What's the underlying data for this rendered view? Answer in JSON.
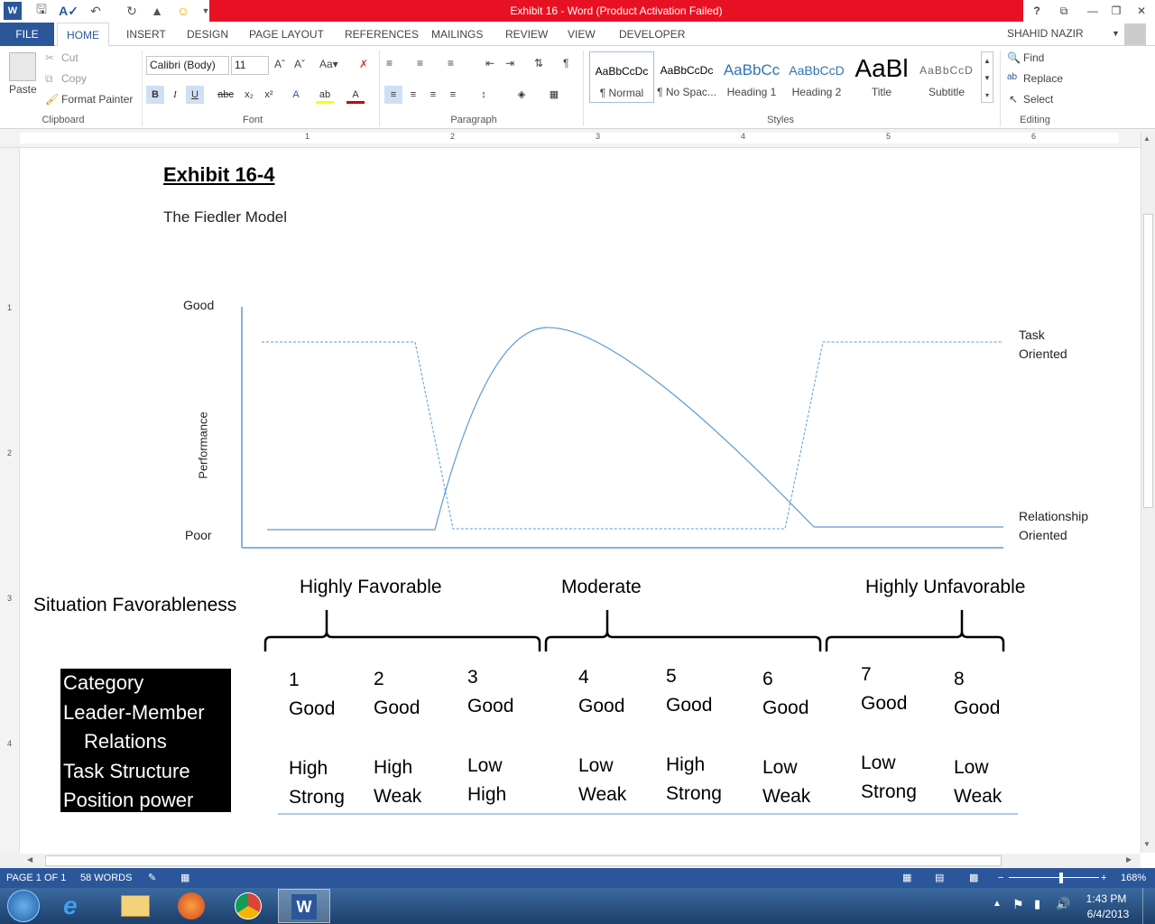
{
  "window": {
    "title": "Exhibit 16 -  Word (Product Activation Failed)",
    "help_label": "?"
  },
  "tabs": [
    "FILE",
    "HOME",
    "INSERT",
    "DESIGN",
    "PAGE LAYOUT",
    "REFERENCES",
    "MAILINGS",
    "REVIEW",
    "VIEW",
    "DEVELOPER"
  ],
  "user": "SHAHID NAZIR",
  "clipboard": {
    "paste": "Paste",
    "cut": "Cut",
    "copy": "Copy",
    "format_painter": "Format Painter",
    "label": "Clipboard"
  },
  "font": {
    "name": "Calibri (Body)",
    "size": "11",
    "label": "Font"
  },
  "paragraph": {
    "label": "Paragraph"
  },
  "styles": {
    "label": "Styles",
    "items": [
      {
        "preview": "AaBbCcDc",
        "name": "¶ Normal"
      },
      {
        "preview": "AaBbCcDc",
        "name": "¶ No Spac..."
      },
      {
        "preview": "AaBbCc",
        "name": "Heading 1"
      },
      {
        "preview": "AaBbCcD",
        "name": "Heading 2"
      },
      {
        "preview": "AaBl",
        "name": "Title"
      },
      {
        "preview": "AaBbCcD",
        "name": "Subtitle"
      }
    ]
  },
  "editing": {
    "find": "Find",
    "replace": "Replace",
    "select": "Select",
    "label": "Editing"
  },
  "ruler_numbers": [
    "1",
    "2",
    "3",
    "4",
    "5",
    "6"
  ],
  "vruler_numbers": [
    "1",
    "2",
    "3",
    "4"
  ],
  "doc": {
    "heading": "Exhibit 16-4",
    "subtitle": "The Fiedler Model",
    "y_good": "Good",
    "y_poor": "Poor",
    "y_axis": "Performance",
    "task_label_1": "Task",
    "task_label_2": "Oriented",
    "rel_label_1": "Relationship",
    "rel_label_2": "Oriented",
    "situation": "Situation Favorableness",
    "fav_high": "Highly Favorable",
    "fav_mod": "Moderate",
    "fav_unfav": "Highly Unfavorable",
    "category_lines": [
      "Category",
      "Leader-Member",
      "Relations",
      "Task Structure",
      "Position power"
    ],
    "columns": [
      {
        "num": "1",
        "lmr": "Good",
        "ts": "High",
        "pp": "Strong"
      },
      {
        "num": "2",
        "lmr": "Good",
        "ts": "High",
        "pp": "Weak"
      },
      {
        "num": "3",
        "lmr": "Good",
        "ts": "Low",
        "pp": "High"
      },
      {
        "num": "4",
        "lmr": "Good",
        "ts": "Low",
        "pp": "Weak"
      },
      {
        "num": "5",
        "lmr": "Good",
        "ts": "High",
        "pp": "Strong"
      },
      {
        "num": "6",
        "lmr": "Good",
        "ts": "Low",
        "pp": "Weak"
      },
      {
        "num": "7",
        "lmr": "Good",
        "ts": "Low",
        "pp": "Strong"
      },
      {
        "num": "8",
        "lmr": "Good",
        "ts": "Low",
        "pp": "Weak"
      }
    ]
  },
  "chart_data": {
    "type": "line",
    "ylabel": "Performance",
    "x": [
      1,
      2,
      3,
      4,
      5,
      6,
      7,
      8
    ],
    "series": [
      {
        "name": "Task Oriented",
        "style": "dashed",
        "values": [
          "high",
          "high",
          "low",
          "low",
          "low",
          "low",
          "high",
          "high"
        ]
      },
      {
        "name": "Relationship Oriented",
        "style": "solid",
        "values": [
          "low",
          "low",
          "peak",
          "high",
          "medium",
          "low",
          "low",
          "low"
        ]
      }
    ]
  },
  "status": {
    "page": "PAGE 1 OF 1",
    "words": "58 WORDS",
    "zoom": "168%"
  },
  "clock": {
    "time": "1:43 PM",
    "date": "6/4/2013"
  },
  "colors": {
    "accent": "#2b579a",
    "title_red": "#e81123",
    "line": "#5b9bd5"
  }
}
